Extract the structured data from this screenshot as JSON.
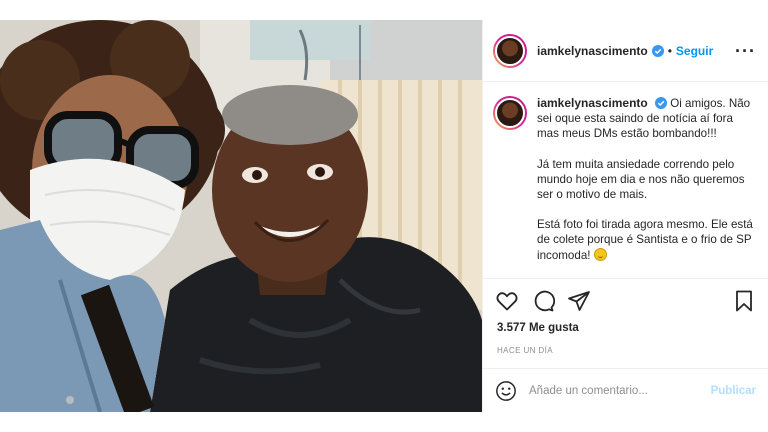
{
  "post": {
    "username": "iamkelynascimento",
    "follow_label": "Seguir",
    "separator": "•",
    "more_label": "···",
    "caption": {
      "username": "iamkelynascimento",
      "paragraphs": [
        "Oi amigos. Não sei oque esta saindo de notícia aí fora mas meus DMs estão bombando!!!",
        "Já tem muita ansiedade correndo pelo mundo hoje em dia e nos não queremos ser o motivo de mais.",
        "Está foto foi tirada agora mesmo. Ele está de colete porque é Santista e o frio de SP incomoda!"
      ],
      "emoji": "smiling-face-emoji"
    },
    "likes": "3.577 Me gusta",
    "timestamp": "HACE UN DÍA",
    "comment": {
      "placeholder": "Añade un comentario...",
      "publish_label": "Publicar"
    },
    "icons": {
      "like": "heart-icon",
      "comment": "comment-bubble-icon",
      "share": "paper-plane-icon",
      "save": "bookmark-icon",
      "emoji": "emoji-smile-icon",
      "verified": "verified-badge-icon"
    },
    "colors": {
      "link": "#0095f6",
      "publish_disabled": "#b2dffc",
      "verified": "#3897f0",
      "muted": "#8e8e8e"
    }
  }
}
